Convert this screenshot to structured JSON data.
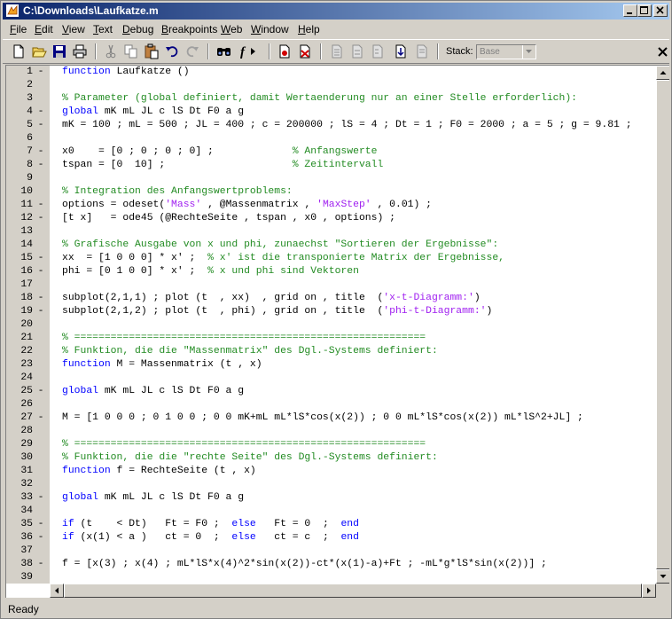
{
  "window": {
    "title": "C:\\Downloads\\Laufkatze.m"
  },
  "menu": [
    {
      "name": "file",
      "label": "File",
      "mnemonic": "F"
    },
    {
      "name": "edit",
      "label": "Edit",
      "mnemonic": "E"
    },
    {
      "name": "view",
      "label": "View",
      "mnemonic": "V"
    },
    {
      "name": "text",
      "label": "Text",
      "mnemonic": "T"
    },
    {
      "name": "debug",
      "label": "Debug",
      "mnemonic": "D"
    },
    {
      "name": "breakpoints",
      "label": "Breakpoints",
      "mnemonic": "B"
    },
    {
      "name": "web",
      "label": "Web",
      "mnemonic": "W"
    },
    {
      "name": "window",
      "label": "Window",
      "mnemonic": "W"
    },
    {
      "name": "help",
      "label": "Help",
      "mnemonic": "H"
    }
  ],
  "toolbar": {
    "icons": [
      "new-file-icon",
      "open-folder-icon",
      "save-icon",
      "print-icon",
      "cut-icon",
      "copy-icon",
      "paste-icon",
      "undo-icon",
      "redo-icon",
      "find-icon",
      "function-browser-icon",
      "set-breakpoint-icon",
      "clear-breakpoints-icon",
      "step-icon",
      "step-in-icon",
      "step-out-icon",
      "continue-icon",
      "exit-debug-icon"
    ],
    "stack_label": "Stack:",
    "stack_value": "Base"
  },
  "editor": {
    "lines": [
      {
        "n": "1",
        "mark": "-",
        "code": "function Laufkatze ()",
        "type": "kwline"
      },
      {
        "n": "2",
        "mark": "",
        "code": "",
        "type": "plain"
      },
      {
        "n": "3",
        "mark": "",
        "code": "% Parameter (global definiert, damit Wertaenderung nur an einer Stelle erforderlich):",
        "type": "comment"
      },
      {
        "n": "4",
        "mark": "-",
        "code": "global mK mL JL c lS Dt F0 a g",
        "type": "kwline"
      },
      {
        "n": "5",
        "mark": "-",
        "code": "mK = 100 ; mL = 500 ; JL = 400 ; c = 200000 ; lS = 4 ; Dt = 1 ; F0 = 2000 ; a = 5 ; g = 9.81 ;",
        "type": "plain"
      },
      {
        "n": "6",
        "mark": "",
        "code": "",
        "type": "plain"
      },
      {
        "n": "7",
        "mark": "-",
        "code": "x0    = [0 ; 0 ; 0 ; 0] ;",
        "comment": "% Anfangswerte",
        "type": "trail"
      },
      {
        "n": "8",
        "mark": "-",
        "code": "tspan = [0  10] ;",
        "comment": "% Zeitintervall",
        "type": "trail"
      },
      {
        "n": "9",
        "mark": "",
        "code": "",
        "type": "plain"
      },
      {
        "n": "10",
        "mark": "",
        "code": "% Integration des Anfangswertproblems:",
        "type": "comment"
      },
      {
        "n": "11",
        "mark": "-",
        "code": "options = odeset('Mass' , @Massenmatrix , 'MaxStep' , 0.01) ;",
        "type": "strline"
      },
      {
        "n": "12",
        "mark": "-",
        "code": "[t x]   = ode45 (@RechteSeite , tspan , x0 , options) ;",
        "type": "plain"
      },
      {
        "n": "13",
        "mark": "",
        "code": "",
        "type": "plain"
      },
      {
        "n": "14",
        "mark": "",
        "code": "% Grafische Ausgabe von x und phi, zunaechst \"Sortieren der Ergebnisse\":",
        "type": "comment"
      },
      {
        "n": "15",
        "mark": "-",
        "code": "xx  = [1 0 0 0] * x' ;",
        "comment": "% x' ist die transponierte Matrix der Ergebnisse,",
        "type": "trail2"
      },
      {
        "n": "16",
        "mark": "-",
        "code": "phi = [0 1 0 0] * x' ;",
        "comment": "% x und phi sind Vektoren",
        "type": "trail2"
      },
      {
        "n": "17",
        "mark": "",
        "code": "",
        "type": "plain"
      },
      {
        "n": "18",
        "mark": "-",
        "code": "subplot(2,1,1) ; plot (t  , xx)  , grid on , title  ('x-t-Diagramm:')",
        "type": "strline"
      },
      {
        "n": "19",
        "mark": "-",
        "code": "subplot(2,1,2) ; plot (t  , phi) , grid on , title  ('phi-t-Diagramm:')",
        "type": "strline"
      },
      {
        "n": "20",
        "mark": "",
        "code": "",
        "type": "plain"
      },
      {
        "n": "21",
        "mark": "",
        "code": "% ==========================================================",
        "type": "comment"
      },
      {
        "n": "22",
        "mark": "",
        "code": "% Funktion, die die \"Massenmatrix\" des Dgl.-Systems definiert:",
        "type": "comment"
      },
      {
        "n": "23",
        "mark": "",
        "code": "function M = Massenmatrix (t , x)",
        "type": "kwline"
      },
      {
        "n": "24",
        "mark": "",
        "code": "",
        "type": "plain"
      },
      {
        "n": "25",
        "mark": "-",
        "code": "global mK mL JL c lS Dt F0 a g",
        "type": "kwline"
      },
      {
        "n": "26",
        "mark": "",
        "code": "",
        "type": "plain"
      },
      {
        "n": "27",
        "mark": "-",
        "code": "M = [1 0 0 0 ; 0 1 0 0 ; 0 0 mK+mL mL*lS*cos(x(2)) ; 0 0 mL*lS*cos(x(2)) mL*lS^2+JL] ;",
        "type": "plain"
      },
      {
        "n": "28",
        "mark": "",
        "code": "",
        "type": "plain"
      },
      {
        "n": "29",
        "mark": "",
        "code": "% ==========================================================",
        "type": "comment"
      },
      {
        "n": "30",
        "mark": "",
        "code": "% Funktion, die die \"rechte Seite\" des Dgl.-Systems definiert:",
        "type": "comment"
      },
      {
        "n": "31",
        "mark": "",
        "code": "function f = RechteSeite (t , x)",
        "type": "kwline"
      },
      {
        "n": "32",
        "mark": "",
        "code": "",
        "type": "plain"
      },
      {
        "n": "33",
        "mark": "-",
        "code": "global mK mL JL c lS Dt F0 a g",
        "type": "kwline"
      },
      {
        "n": "34",
        "mark": "",
        "code": "",
        "type": "plain"
      },
      {
        "n": "35",
        "mark": "-",
        "code": "if (t    < Dt)   Ft = F0 ;  else   Ft = 0  ;  end",
        "type": "ifline"
      },
      {
        "n": "36",
        "mark": "-",
        "code": "if (x(1) < a )   ct = 0  ;  else   ct = c  ;  end",
        "type": "ifline"
      },
      {
        "n": "37",
        "mark": "",
        "code": "",
        "type": "plain"
      },
      {
        "n": "38",
        "mark": "-",
        "code": "f = [x(3) ; x(4) ; mL*lS*x(4)^2*sin(x(2))-ct*(x(1)-a)+Ft ; -mL*g*lS*sin(x(2))] ;",
        "type": "plain"
      },
      {
        "n": "39",
        "mark": "",
        "code": "",
        "type": "plain"
      }
    ]
  },
  "status": {
    "text": "Ready"
  },
  "colors": {
    "keyword": "#0000ff",
    "comment": "#228b22",
    "string": "#a020f0",
    "title_active": "#0a246a"
  }
}
